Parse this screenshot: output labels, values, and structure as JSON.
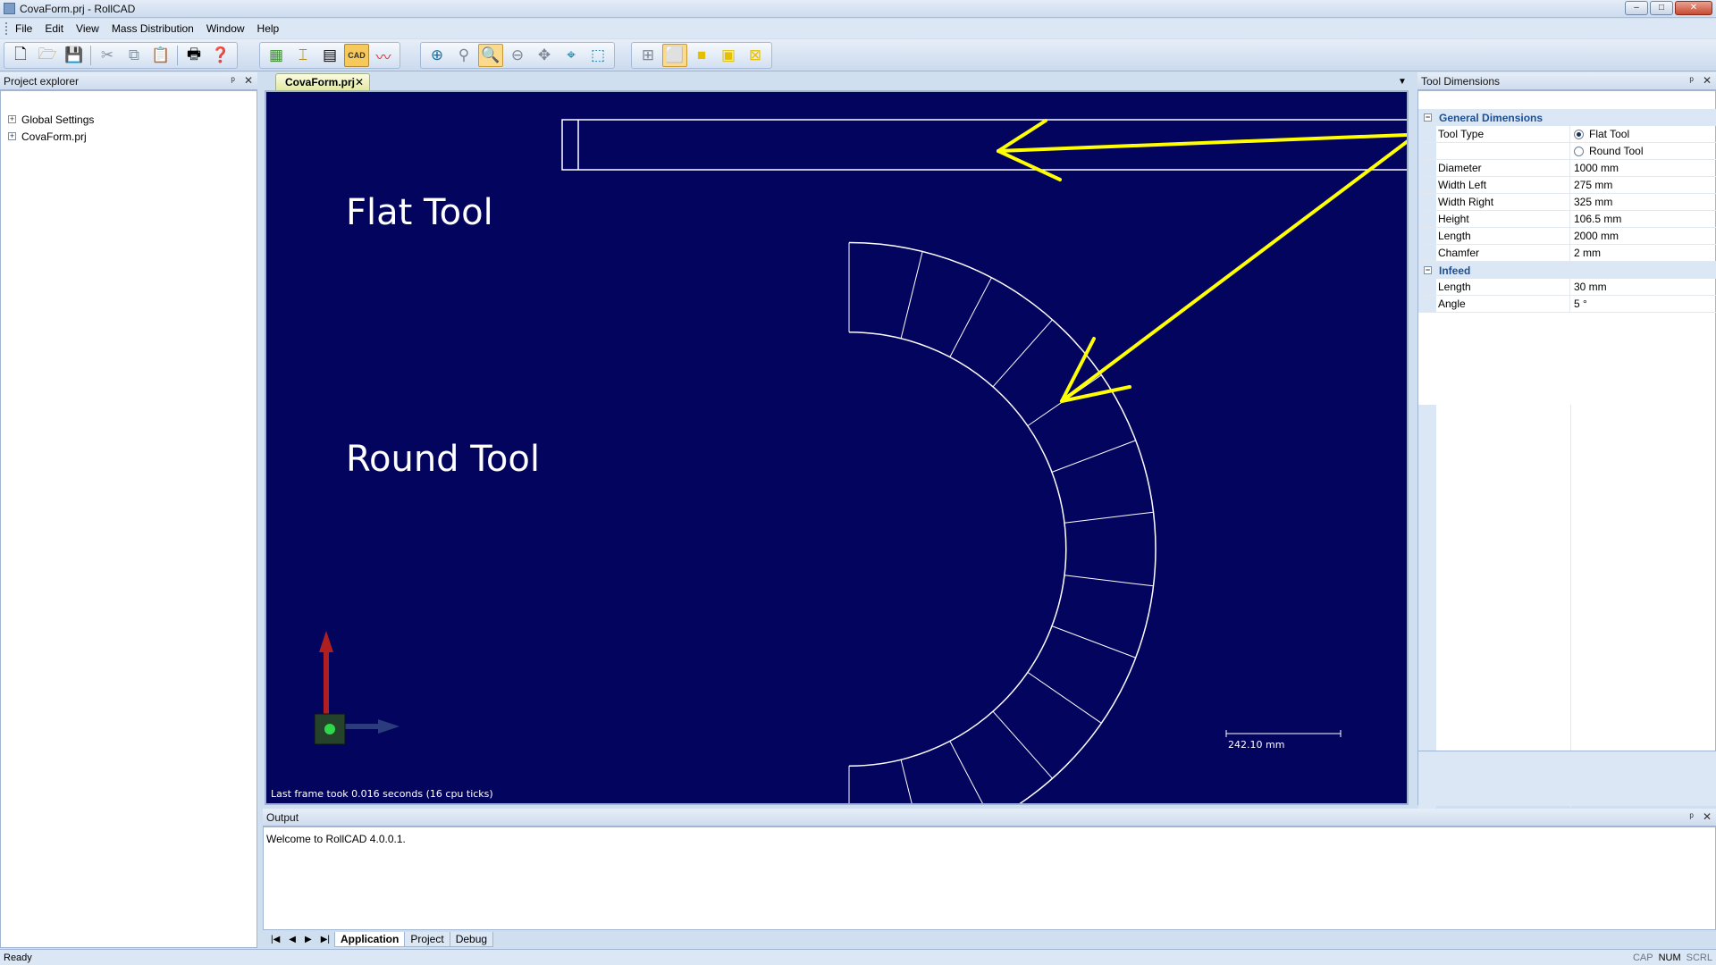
{
  "window": {
    "title": "CovaForm.prj - RollCAD",
    "buttons": {
      "minimize": "–",
      "maximize": "□",
      "close": "✕"
    }
  },
  "menu": [
    "File",
    "Edit",
    "View",
    "Mass Distribution",
    "Window",
    "Help"
  ],
  "toolbar": {
    "icons": [
      "new-file-icon",
      "open-folder-icon",
      "save-icon",
      "cut-icon",
      "copy-icon",
      "paste-icon",
      "print-icon",
      "help-icon",
      "grid-tool-icon",
      "measure-icon",
      "table-icon",
      "cad-icon",
      "chart-icon",
      "zoom-extents-icon",
      "zoom-pan-icon",
      "zoom-in-icon",
      "zoom-out-icon",
      "pan-icon",
      "fit-icon",
      "zoom-window-icon",
      "view-front-icon",
      "view-box-icon",
      "view-solid-icon",
      "view-iso-icon",
      "view-cross-icon"
    ],
    "cad_label": "CAD"
  },
  "project_explorer": {
    "title": "Project explorer",
    "pin": "ᵖ",
    "close": "✕",
    "items": [
      "Global Settings",
      "CovaForm.prj"
    ]
  },
  "document_tab": {
    "label": "CovaForm.prj",
    "close": "✕",
    "menu": "▼"
  },
  "viewport": {
    "labels": {
      "flat": "Flat Tool",
      "round": "Round Tool"
    },
    "scale_label": "242.10 mm",
    "frame_info": "Last frame took 0.016 seconds (16 cpu ticks)"
  },
  "tool_dimensions": {
    "title": "Tool Dimensions",
    "pin": "ᵖ",
    "close": "✕",
    "sections": {
      "general": {
        "title": "General Dimensions",
        "tool_type_label": "Tool Type",
        "options": [
          "Flat Tool",
          "Round Tool"
        ],
        "selected": "Flat Tool",
        "rows": [
          {
            "name": "Diameter",
            "value": "1000 mm"
          },
          {
            "name": "Width Left",
            "value": "275 mm"
          },
          {
            "name": "Width Right",
            "value": "325 mm"
          },
          {
            "name": "Height",
            "value": "106.5 mm"
          },
          {
            "name": "Length",
            "value": "2000 mm"
          },
          {
            "name": "Chamfer",
            "value": "2 mm"
          }
        ]
      },
      "infeed": {
        "title": "Infeed",
        "rows": [
          {
            "name": "Length",
            "value": "30 mm"
          },
          {
            "name": "Angle",
            "value": "5 °"
          }
        ]
      }
    }
  },
  "output": {
    "title": "Output",
    "pin": "ᵖ",
    "close": "✕",
    "text": "Welcome to RollCAD 4.0.0.1.",
    "tabs": [
      "Application",
      "Project",
      "Debug"
    ],
    "active_tab": "Application"
  },
  "status": {
    "text": "Ready",
    "indicators": [
      {
        "label": "CAP",
        "active": false
      },
      {
        "label": "NUM",
        "active": true
      },
      {
        "label": "SCRL",
        "active": false
      }
    ]
  },
  "colors": {
    "viewport_bg": "#03045e",
    "arrow": "#ffff00",
    "drawing": "#ffffff"
  }
}
